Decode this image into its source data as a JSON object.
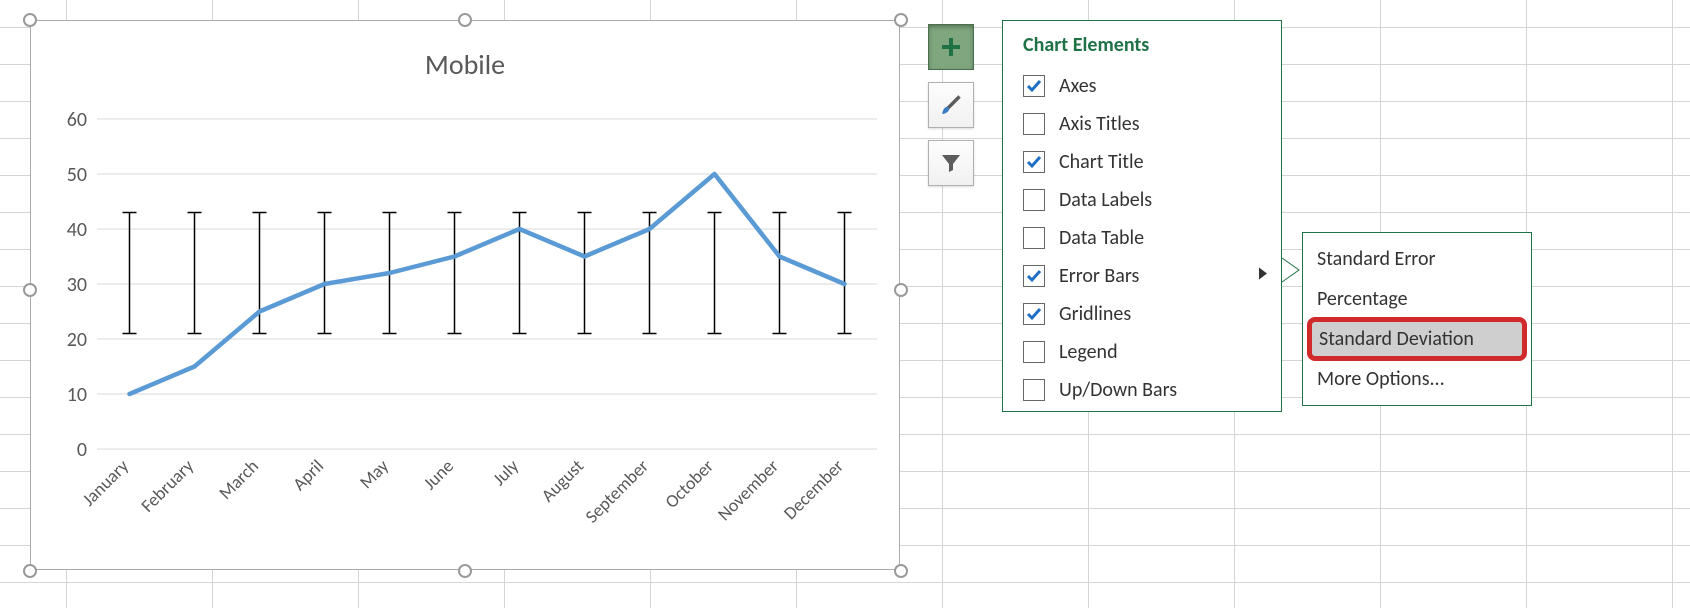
{
  "chart": {
    "title": "Mobile"
  },
  "chart_data": {
    "type": "line",
    "title": "Mobile",
    "categories": [
      "January",
      "February",
      "March",
      "April",
      "May",
      "June",
      "July",
      "August",
      "September",
      "October",
      "November",
      "December"
    ],
    "values": [
      10,
      15,
      25,
      30,
      32,
      35,
      40,
      35,
      40,
      50,
      35,
      30
    ],
    "ylabel": "",
    "xlabel": "",
    "y_ticks": [
      0,
      10,
      20,
      30,
      40,
      50,
      60
    ],
    "ylim": [
      0,
      60
    ],
    "error_bars": {
      "type": "standard_deviation",
      "low": 21,
      "high": 43
    },
    "gridlines": true
  },
  "chart_elements": {
    "title": "Chart Elements",
    "items": [
      {
        "label": "Axes",
        "checked": true
      },
      {
        "label": "Axis Titles",
        "checked": false
      },
      {
        "label": "Chart Title",
        "checked": true
      },
      {
        "label": "Data Labels",
        "checked": false
      },
      {
        "label": "Data Table",
        "checked": false
      },
      {
        "label": "Error Bars",
        "checked": true,
        "has_submenu": true
      },
      {
        "label": "Gridlines",
        "checked": true
      },
      {
        "label": "Legend",
        "checked": false
      },
      {
        "label": "Up/Down Bars",
        "checked": false
      }
    ]
  },
  "error_bars_submenu": {
    "items": [
      {
        "label": "Standard Error"
      },
      {
        "label": "Percentage"
      },
      {
        "label": "Standard Deviation",
        "highlighted": true
      },
      {
        "label": "More Options..."
      }
    ]
  },
  "side_buttons": {
    "add": "plus-icon",
    "style": "brush-icon",
    "filter": "funnel-icon"
  }
}
